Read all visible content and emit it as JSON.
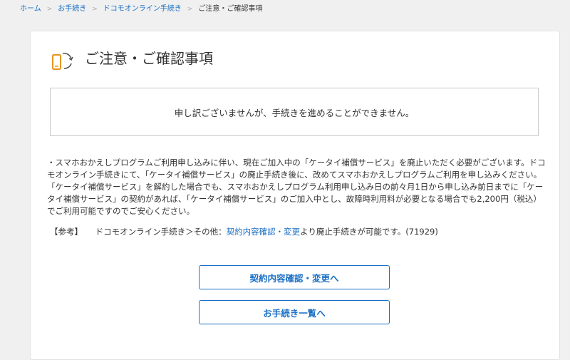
{
  "breadcrumb": {
    "items": [
      "ホーム",
      "お手続き",
      "ドコモオンライン手続き"
    ],
    "current": "ご注意・ご確認事項"
  },
  "header": {
    "icon": "phone-refresh-icon",
    "title": "ご注意・ご確認事項"
  },
  "notice": {
    "message": "申し訳ございませんが、手続きを進めることができません。"
  },
  "body": {
    "text": "・スマホおかえしプログラムご利用申し込みに伴い、現在ご加入中の「ケータイ補償サービス」を廃止いただく必要がございます。ドコモオンライン手続きにて、「ケータイ補償サービス」の廃止手続き後に、改めてスマホおかえしプログラムご利用を申し込みください。「ケータイ補償サービス」を解約した場合でも、スマホおかえしプログラム利用申し込み日の前々月1日から申し込み前日までに「ケータイ補償サービス」の契約があれば、「ケータイ補償サービス」のご加入中とし、故障時利用料が必要となる場合でも2,200円（税込）でご利用可能ですのでご安心ください。"
  },
  "reference": {
    "tag": "【参考】",
    "prefix": "ドコモオンライン手続き＞その他：",
    "link": "契約内容確認・変更",
    "suffix": "より廃止手続きが可能です。(71929)"
  },
  "buttons": {
    "contract_label": "契約内容確認・変更へ",
    "procedures_label": "お手続き一覧へ"
  },
  "colors": {
    "link": "#1a6fc4",
    "icon_orange": "#e8951e"
  }
}
